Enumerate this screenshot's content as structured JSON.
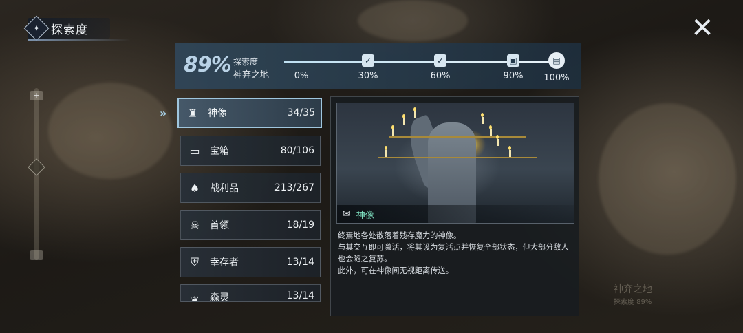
{
  "header": {
    "title": "探索度",
    "emblem_icon": "compass-emblem-icon",
    "close_icon": "close-x-icon"
  },
  "progress": {
    "percent": "89%",
    "label": "探索度",
    "region": "神弃之地",
    "value": 0.89,
    "milestones": [
      {
        "label": "0%",
        "icon": "none"
      },
      {
        "label": "30%",
        "icon": "check-icon"
      },
      {
        "label": "60%",
        "icon": "check-icon"
      },
      {
        "label": "90%",
        "icon": "reward-chest-icon"
      },
      {
        "label": "100%",
        "icon": "reward-book-icon"
      }
    ]
  },
  "categories": [
    {
      "name": "神像",
      "count": "34/35",
      "icon": "statue-icon",
      "active": true
    },
    {
      "name": "宝箱",
      "count": "80/106",
      "icon": "chest-icon",
      "active": false
    },
    {
      "name": "战利品",
      "count": "213/267",
      "icon": "loot-bag-icon",
      "active": false
    },
    {
      "name": "首领",
      "count": "18/19",
      "icon": "boss-skull-icon",
      "active": false
    },
    {
      "name": "幸存者",
      "count": "13/14",
      "icon": "survivor-helmet-icon",
      "active": false
    },
    {
      "name": "森灵",
      "count": "13/14",
      "icon": "forest-spirit-icon",
      "active": false
    }
  ],
  "detail": {
    "caption": "神像",
    "caption_icon": "mail-envelope-icon",
    "description": [
      "终焉地各处散落着残存魔力的神像。",
      "与其交互即可激活，将其设为复活点并恢复全部状态，但大部分敌人也会随之复苏。",
      "此外，可在神像间无视距离传送。"
    ]
  },
  "map_region": {
    "name": "神弃之地",
    "sub": "探索度 89%"
  },
  "colors": {
    "accent": "#9fc6de",
    "caption_green": "#7ee0c0"
  }
}
